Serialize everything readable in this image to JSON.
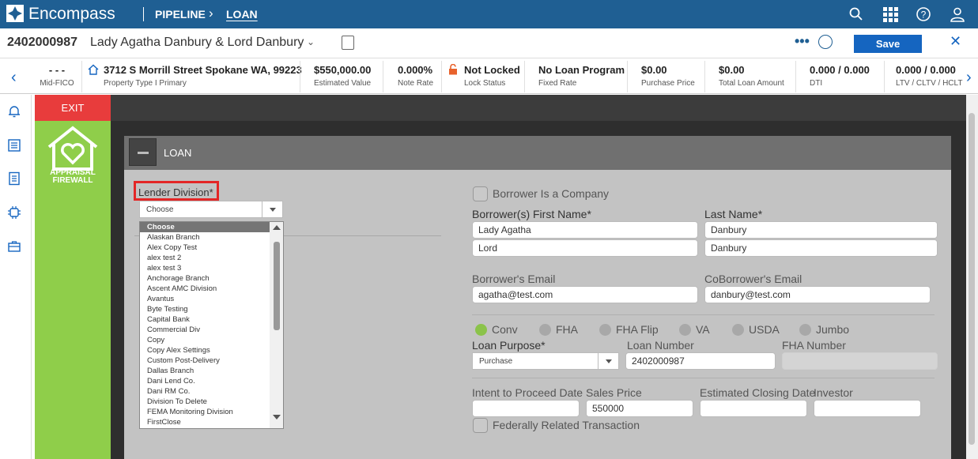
{
  "topbar": {
    "brand": "Encompass",
    "crumb1": "PIPELINE",
    "crumb2": "LOAN"
  },
  "header": {
    "loan_number": "2402000987",
    "borrower_name": "Lady Agatha Danbury & Lord Danbury",
    "more": "•••",
    "save_label": "Save",
    "close": "✕"
  },
  "infobar": {
    "items": [
      {
        "value": "- - -",
        "label": "Mid-FICO"
      },
      {
        "value": "3712 S Morrill Street Spokane WA, 99223",
        "label": "Property Type I Primary"
      },
      {
        "value": "$550,000.00",
        "label": "Estimated Value"
      },
      {
        "value": "0.000%",
        "label": "Note Rate"
      },
      {
        "value": "Not Locked",
        "label": "Lock Status"
      },
      {
        "value": "No Loan Program",
        "label": "Fixed Rate"
      },
      {
        "value": "$0.00",
        "label": "Purchase Price"
      },
      {
        "value": "$0.00",
        "label": "Total Loan Amount"
      },
      {
        "value": "0.000 / 0.000",
        "label": "DTI"
      },
      {
        "value": "0.000 / 0.000",
        "label": "LTV / CLTV / HCLT"
      }
    ]
  },
  "sidebar": {
    "exit_label": "EXIT",
    "app_line1": "APPRAISAL",
    "app_line2": "FIREWALL"
  },
  "panel": {
    "title": "LOAN"
  },
  "form": {
    "lender_division_label": "Lender Division*",
    "lender_division_value": "Choose",
    "lender_division_options": [
      "Choose",
      "Alaskan Branch",
      "Alex Copy Test",
      "alex test 2",
      "alex test 3",
      "Anchorage Branch",
      "Ascent AMC Division",
      "Avantus",
      "Byte Testing",
      "Capital Bank",
      "Commercial Div",
      "Copy",
      "Copy Alex Settings",
      "Custom Post-Delivery",
      "Dallas Branch",
      "Dani Lend Co.",
      "Dani RM Co.",
      "Division To Delete",
      "FEMA Monitoring Division",
      "FirstClose"
    ],
    "borrower_is_company": "Borrower Is a Company",
    "first_name_label": "Borrower(s) First Name*",
    "last_name_label": "Last Name*",
    "first_name_1": "Lady Agatha",
    "last_name_1": "Danbury",
    "first_name_2": "Lord",
    "last_name_2": "Danbury",
    "borrower_email_label": "Borrower's Email",
    "coborrower_email_label": "CoBorrower's Email",
    "borrower_email": "agatha@test.com",
    "coborrower_email": "danbury@test.com",
    "loan_types": [
      "Conv",
      "FHA",
      "FHA Flip",
      "VA",
      "USDA",
      "Jumbo"
    ],
    "loan_purpose_label": "Loan Purpose*",
    "loan_purpose_value": "Purchase",
    "loan_number_label": "Loan Number",
    "loan_number_value": "2402000987",
    "fha_number_label": "FHA Number",
    "intent_label": "Intent to Proceed Date",
    "sales_price_label": "Sales Price",
    "sales_price_value": "550000",
    "closing_date_label": "Estimated Closing Date",
    "investor_label": "Investor",
    "federally_related": "Federally Related Transaction"
  },
  "colors": {
    "topbar": "#1f5f93",
    "save_button": "#1565c0",
    "exit": "#e83c3c",
    "app_panel": "#8fce4a",
    "highlight": "#e32626"
  }
}
